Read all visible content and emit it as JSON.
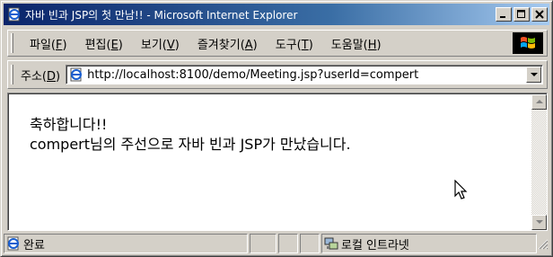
{
  "window": {
    "title": "자바 빈과 JSP의 첫 만남!! - Microsoft Internet Explorer",
    "minimize_glyph": "_",
    "maximize_glyph": "□",
    "close_glyph": "✕"
  },
  "menu": {
    "items": [
      {
        "label": "파일",
        "key": "F"
      },
      {
        "label": "편집",
        "key": "E"
      },
      {
        "label": "보기",
        "key": "V"
      },
      {
        "label": "즐겨찾기",
        "key": "A"
      },
      {
        "label": "도구",
        "key": "T"
      },
      {
        "label": "도움말",
        "key": "H"
      }
    ]
  },
  "address": {
    "label": "주소",
    "key": "D",
    "url": "http://localhost:8100/demo/Meeting.jsp?userId=compert"
  },
  "content": {
    "line1": "축하합니다!!",
    "line2": "compert님의 주선으로 자바 빈과 JSP가 만났습니다."
  },
  "status": {
    "text": "완료",
    "zone": "로컬 인트라넷"
  },
  "icons": {
    "title": "ie-page-icon",
    "address": "ie-page-icon",
    "status": "ie-page-icon",
    "zone": "network-computer-icon",
    "logo": "windows-logo-icon"
  },
  "colors": {
    "titlebar_start": "#0a246a",
    "titlebar_end": "#a6caf0",
    "chrome": "#d4d0c8"
  }
}
